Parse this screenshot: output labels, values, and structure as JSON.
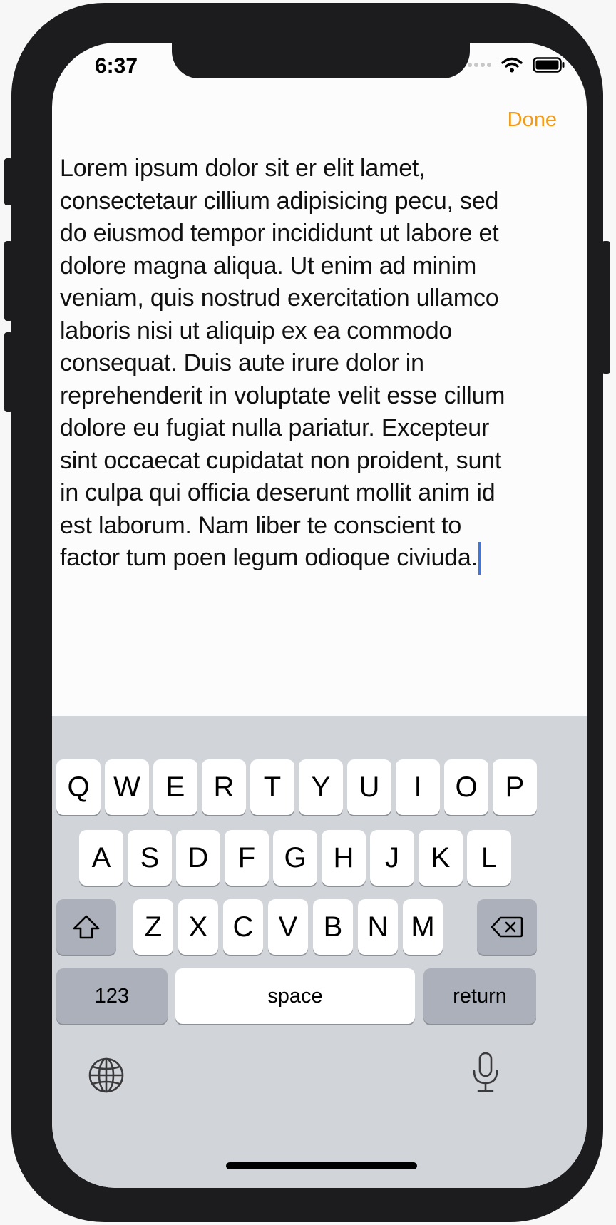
{
  "status_bar": {
    "time": "6:37"
  },
  "nav": {
    "done_label": "Done"
  },
  "editor": {
    "text": "Lorem ipsum dolor sit er elit lamet,\nconsectetaur cillium adipisicing pecu, sed\ndo eiusmod tempor incididunt ut labore et\ndolore magna aliqua. Ut enim ad minim\nveniam, quis nostrud exercitation ullamco\nlaboris nisi ut aliquip ex ea commodo\nconsequat. Duis aute irure dolor in\nreprehenderit in voluptate velit esse cillum\ndolore eu fugiat nulla pariatur. Excepteur\nsint occaecat cupidatat non proident, sunt\nin culpa qui officia deserunt mollit anim id\nest laborum. Nam liber te conscient to\nfactor tum poen legum odioque civiuda."
  },
  "keyboard": {
    "row1": [
      "Q",
      "W",
      "E",
      "R",
      "T",
      "Y",
      "U",
      "I",
      "O",
      "P"
    ],
    "row2": [
      "A",
      "S",
      "D",
      "F",
      "G",
      "H",
      "J",
      "K",
      "L"
    ],
    "row3": [
      "Z",
      "X",
      "C",
      "V",
      "B",
      "N",
      "M"
    ],
    "numbers_label": "123",
    "space_label": "space",
    "return_label": "return",
    "shift_icon": "shift-icon",
    "delete_icon": "delete-icon",
    "globe_icon": "globe-icon",
    "mic_icon": "microphone-icon"
  },
  "colors": {
    "accent": "#f29b1b",
    "caret": "#3b78e7",
    "keyboard_bg": "#d1d4d9",
    "key_bg": "#ffffff",
    "key_dark_bg": "#abb0ba"
  }
}
